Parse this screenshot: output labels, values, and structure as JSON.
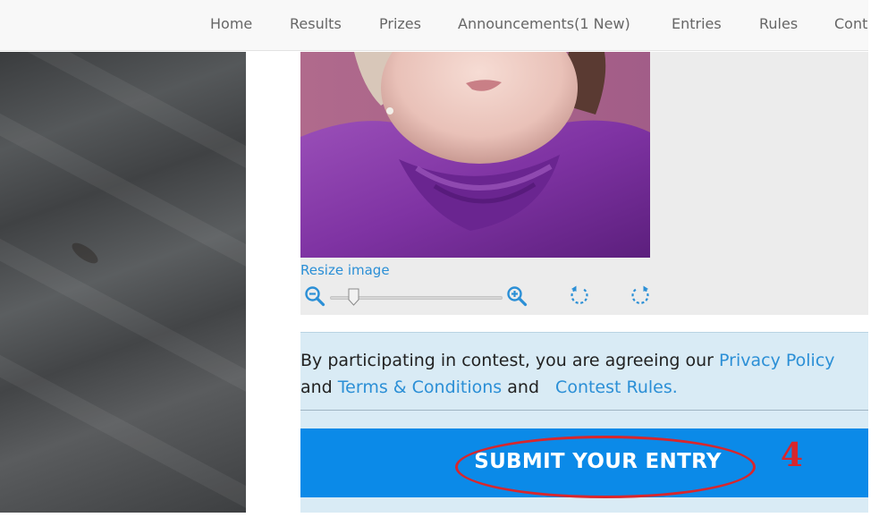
{
  "nav": {
    "items": [
      {
        "label": "Home"
      },
      {
        "label": "Results"
      },
      {
        "label": "Prizes"
      },
      {
        "label": "Announcements(1 New)"
      },
      {
        "label": "Entries"
      },
      {
        "label": "Rules"
      },
      {
        "label": "Cont"
      }
    ]
  },
  "cropper": {
    "resize_label": "Resize image",
    "zoom_level": 0.14,
    "icons": {
      "zoom_out": "zoom-out-icon",
      "zoom_in": "zoom-in-icon",
      "rotate_left": "rotate-left-icon",
      "rotate_right": "rotate-right-icon"
    }
  },
  "agreement": {
    "text_before": "By participating in contest, you are agreeing our ",
    "privacy_link": "Privacy Policy",
    "text_and_1": " and ",
    "terms_link": "Terms & Conditions",
    "text_and_2": " and ",
    "rules_link": "Contest Rules."
  },
  "submit": {
    "label": "SUBMIT YOUR ENTRY"
  },
  "annotation": {
    "step": "4",
    "color": "#d8262c"
  },
  "colors": {
    "accent": "#0b8ae8",
    "link": "#2b8fd6",
    "agreement_bg": "#d9ebf5"
  }
}
